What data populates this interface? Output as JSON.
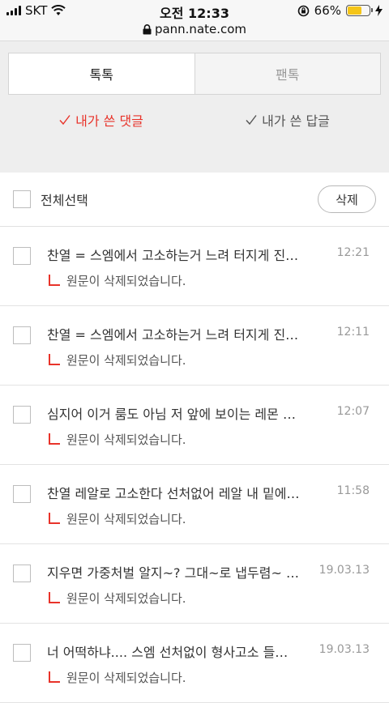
{
  "status_bar": {
    "carrier": "SKT",
    "time": "오전 12:33",
    "battery_percent": "66%",
    "battery_level": 0.66,
    "icons": [
      "signal-icon",
      "wifi-icon",
      "orientation-lock-icon",
      "battery-icon",
      "charging-icon"
    ]
  },
  "url_bar": {
    "url": "pann.nate.com",
    "icon": "lock-icon"
  },
  "tabs": [
    {
      "label": "톡톡",
      "active": true
    },
    {
      "label": "팬톡",
      "active": false
    }
  ],
  "subtabs": [
    {
      "label": "내가 쓴 댓글",
      "active": true
    },
    {
      "label": "내가 쓴 답글",
      "active": false
    }
  ],
  "select_all": {
    "label": "전체선택",
    "delete_label": "삭제"
  },
  "comments": [
    {
      "text": "찬열 = 스엠에서 고소하는거 느려 터지게 진행되는",
      "time": "12:21",
      "reply": "원문이 삭제되었습니다."
    },
    {
      "text": "찬열 = 스엠에서 고소하는거 느려 터지게 진행되는",
      "time": "12:11",
      "reply": "원문이 삭제되었습니다."
    },
    {
      "text": "심지어 이거 룸도 아님 저 앞에 보이는 레몬 가득",
      "time": "12:07",
      "reply": "원문이 삭제되었습니다."
    },
    {
      "text": "찬열 레알로 고소한다 선처없어 레알 내 밑에 달린",
      "time": "11:58",
      "reply": "원문이 삭제되었습니다."
    },
    {
      "text": "지우면 가중처벌 알지~? 그대~로 냅두렴~ 아 그리고",
      "time": "19.03.13",
      "reply": "원문이 삭제되었습니다."
    },
    {
      "text": "너 어떡하냐.... 스엠 선처없이 형사고소 들어간다던데",
      "time": "19.03.13",
      "reply": "원문이 삭제되었습니다."
    }
  ],
  "colors": {
    "accent": "#e8332a",
    "battery": "#f5c518",
    "background": "#eeeeee"
  }
}
